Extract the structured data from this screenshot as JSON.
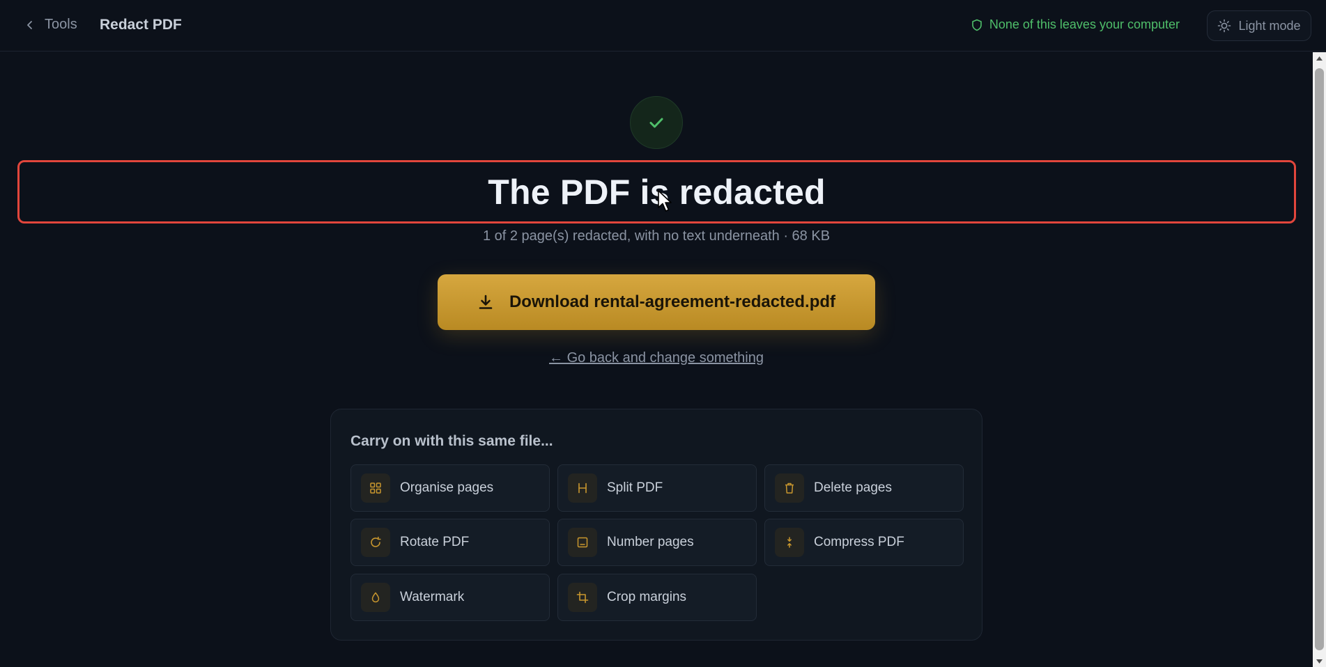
{
  "header": {
    "back_label": "Tools",
    "title": "Redact PDF",
    "privacy_note": "None of this leaves your computer",
    "theme_label": "Light mode"
  },
  "result": {
    "headline": "The PDF is redacted",
    "summary": "1 of 2 page(s) redacted, with no text underneath · 68 KB",
    "download_label": "Download rental-agreement-redacted.pdf",
    "go_back_label": "← Go back and change something"
  },
  "next_steps": {
    "title": "Carry on with this same file...",
    "tools": [
      {
        "label": "Organise pages",
        "icon": "grid-icon"
      },
      {
        "label": "Split PDF",
        "icon": "split-icon"
      },
      {
        "label": "Delete pages",
        "icon": "trash-icon"
      },
      {
        "label": "Rotate PDF",
        "icon": "rotate-icon"
      },
      {
        "label": "Number pages",
        "icon": "page-number-icon"
      },
      {
        "label": "Compress PDF",
        "icon": "compress-icon"
      },
      {
        "label": "Watermark",
        "icon": "droplet-icon"
      },
      {
        "label": "Crop margins",
        "icon": "crop-icon"
      }
    ]
  },
  "colors": {
    "background": "#0c111a",
    "accent": "#c9972e",
    "success": "#4fbf6a",
    "highlight_border": "#e2463c"
  }
}
